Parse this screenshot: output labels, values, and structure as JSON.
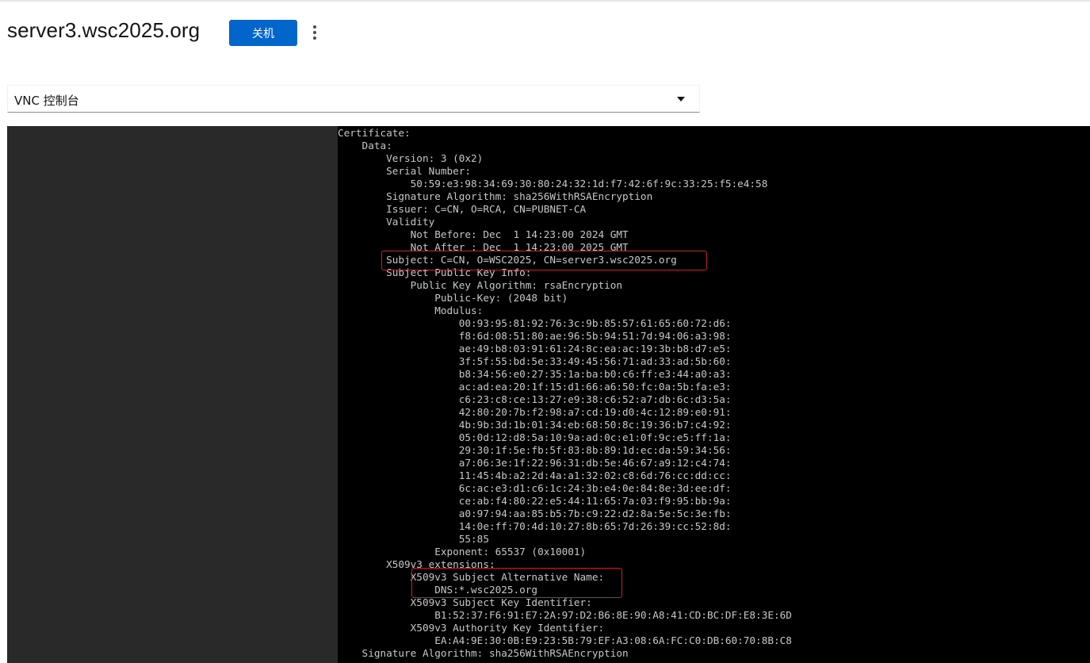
{
  "header": {
    "title": "server3.wsc2025.org",
    "shutdown_label": "关机"
  },
  "console_select": {
    "selected": "VNC 控制台"
  },
  "terminal": {
    "lines": [
      "Certificate:",
      "    Data:",
      "        Version: 3 (0x2)",
      "        Serial Number:",
      "            50:59:e3:98:34:69:30:80:24:32:1d:f7:42:6f:9c:33:25:f5:e4:58",
      "        Signature Algorithm: sha256WithRSAEncryption",
      "        Issuer: C=CN, O=RCA, CN=PUBNET-CA",
      "        Validity",
      "            Not Before: Dec  1 14:23:00 2024 GMT",
      "            Not After : Dec  1 14:23:00 2025 GMT",
      "        Subject: C=CN, O=WSC2025, CN=server3.wsc2025.org",
      "        Subject Public Key Info:",
      "            Public Key Algorithm: rsaEncryption",
      "                Public-Key: (2048 bit)",
      "                Modulus:",
      "                    00:93:95:81:92:76:3c:9b:85:57:61:65:60:72:d6:",
      "                    f8:6d:08:51:80:ae:96:5b:94:51:7d:94:06:a3:98:",
      "                    ae:49:b8:03:91:61:24:8c:ea:ac:19:3b:b8:d7:e5:",
      "                    3f:5f:55:bd:5e:33:49:45:56:71:ad:33:ad:5b:60:",
      "                    b8:34:56:e0:27:35:1a:ba:b0:c6:ff:e3:44:a0:a3:",
      "                    ac:ad:ea:20:1f:15:d1:66:a6:50:fc:0a:5b:fa:e3:",
      "                    c6:23:c8:ce:13:27:e9:38:c6:52:a7:db:6c:d3:5a:",
      "                    42:80:20:7b:f2:98:a7:cd:19:d0:4c:12:89:e0:91:",
      "                    4b:9b:3d:1b:01:34:eb:68:50:8c:19:36:b7:c4:92:",
      "                    05:0d:12:d8:5a:10:9a:ad:0c:e1:0f:9c:e5:ff:1a:",
      "                    29:30:1f:5e:fb:5f:83:8b:89:1d:ec:da:59:34:56:",
      "                    a7:06:3e:1f:22:96:31:db:5e:46:67:a9:12:c4:74:",
      "                    11:45:4b:a2:2d:4a:a1:32:02:c8:6d:76:cc:dd:cc:",
      "                    6c:ac:e3:d1:c6:1c:24:3b:e4:0e:84:8e:3d:ee:df:",
      "                    ce:ab:f4:80:22:e5:44:11:65:7a:03:f9:95:bb:9a:",
      "                    a0:97:94:aa:85:b5:7b:c9:22:d2:8a:5e:5c:3e:fb:",
      "                    14:0e:ff:70:4d:10:27:8b:65:7d:26:39:cc:52:8d:",
      "                    55:85",
      "                Exponent: 65537 (0x10001)",
      "        X509v3 extensions:",
      "            X509v3 Subject Alternative Name:",
      "                DNS:*.wsc2025.org",
      "            X509v3 Subject Key Identifier:",
      "                B1:52:37:F6:91:E7:2A:97:D2:B6:8E:90:A8:41:CD:BC:DF:E8:3E:6D",
      "            X509v3 Authority Key Identifier:",
      "                EA:A4:9E:30:0B:E9:23:5B:79:EF:A3:08:6A:FC:C0:DB:60:70:8B:C8",
      "    Signature Algorithm: sha256WithRSAEncryption"
    ]
  },
  "colors": {
    "primary_button": "#0066cc",
    "vnc_background": "#292929",
    "terminal_background": "#000000",
    "terminal_text": "#c7c7c7",
    "highlight_border": "#c0282e"
  }
}
